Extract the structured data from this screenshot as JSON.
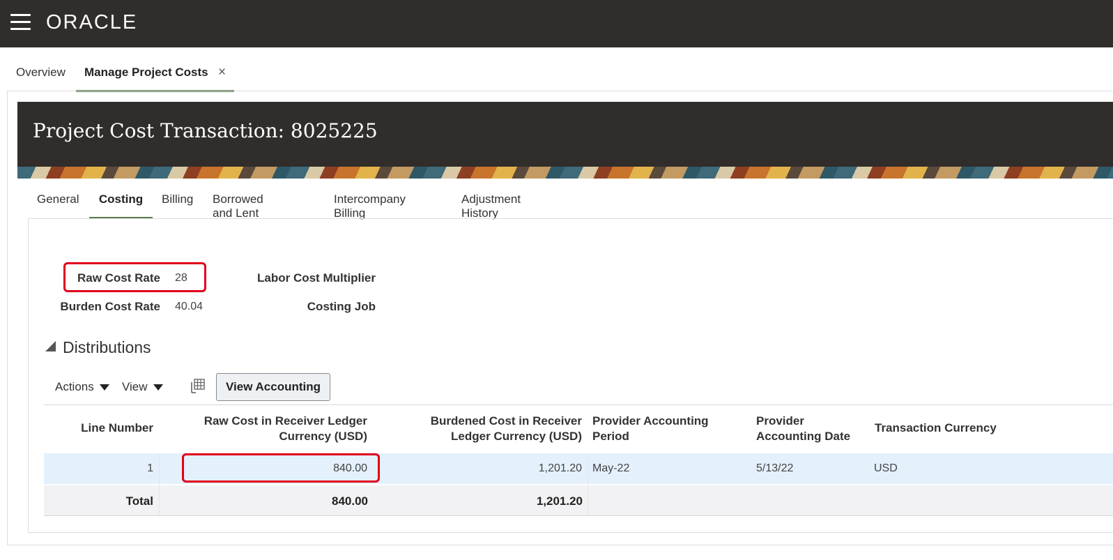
{
  "app": {
    "brand": "ORACLE"
  },
  "tabs": {
    "overview": "Overview",
    "active": "Manage Project Costs",
    "close_glyph": "×"
  },
  "page": {
    "title": "Project Cost Transaction: 8025225"
  },
  "subtabs": [
    "General",
    "Costing",
    "Billing",
    "Borrowed and Lent",
    "Intercompany Billing",
    "Adjustment History"
  ],
  "costing": {
    "raw_cost_rate_label": "Raw Cost Rate",
    "raw_cost_rate": "28",
    "burden_cost_rate_label": "Burden Cost Rate",
    "burden_cost_rate": "40.04",
    "labor_cost_multiplier_label": "Labor Cost Multiplier",
    "costing_job_label": "Costing Job"
  },
  "distributions": {
    "title": "Distributions",
    "actions_label": "Actions",
    "view_label": "View",
    "view_accounting_label": "View Accounting",
    "columns": {
      "line_number": "Line Number",
      "raw_cost_1": "Raw Cost in Receiver Ledger",
      "raw_cost_2": "Currency (USD)",
      "burdened_1": "Burdened Cost in Receiver",
      "burdened_2": "Ledger Currency (USD)",
      "period_1": "Provider Accounting",
      "period_2": "Period",
      "date_1": "Provider",
      "date_2": "Accounting Date",
      "currency": "Transaction Currency"
    },
    "rows": [
      {
        "line_number": "1",
        "raw_cost": "840.00",
        "burdened_cost": "1,201.20",
        "period": "May-22",
        "date": "5/13/22",
        "currency": "USD"
      }
    ],
    "total": {
      "label": "Total",
      "raw_cost": "840.00",
      "burdened_cost": "1,201.20"
    }
  },
  "colors": {
    "highlight_box": "#e0001b",
    "header_bg": "#312d2a",
    "tab_underline": "#5f7d4f",
    "selected_row": "#e4f0fb"
  }
}
